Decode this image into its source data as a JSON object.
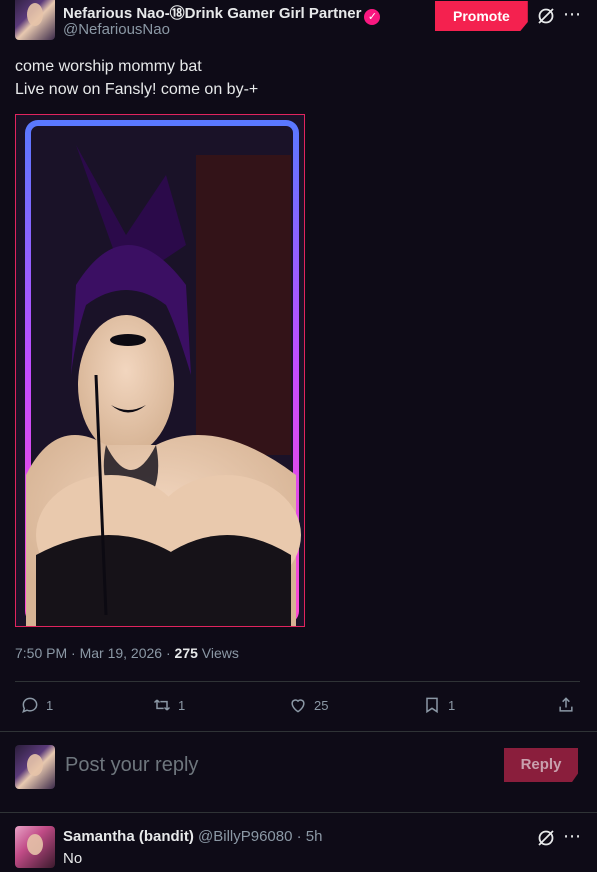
{
  "tweet": {
    "author_name": "Nefarious Nao-⑱Drink Gamer Girl Partner",
    "author_handle": "@NefariousNao",
    "verified_icon": "check-badge-icon",
    "promote_label": "Promote",
    "text_line1": "come worship mommy bat",
    "text_line2": "Live now on Fansly! come on by-+",
    "time": "7:50 PM · Mar 19, 2026 · ",
    "views_count": "275",
    "views_label": " Views"
  },
  "actions": {
    "replies": "1",
    "retweets": "1",
    "likes": "25",
    "bookmarks": "1"
  },
  "composer": {
    "placeholder": "Post your reply",
    "reply_label": "Reply"
  },
  "reply": {
    "author_name": "Samantha (bandit)",
    "author_handle": "@BillyP96080",
    "time": " · 5h",
    "text": "No"
  },
  "colors": {
    "background": "#0e0b17",
    "accent": "#f4214f",
    "muted": "#8b98a5"
  }
}
